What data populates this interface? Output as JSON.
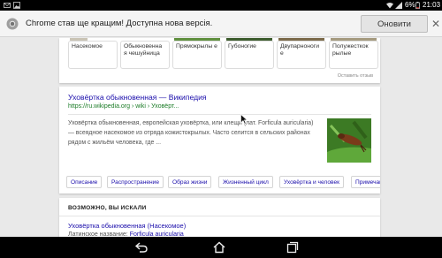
{
  "status_bar": {
    "battery_percent": "6%",
    "time": "21:03",
    "icons": [
      "email-icon",
      "image-icon",
      "wifi-icon",
      "signal-icon",
      "battery-icon"
    ]
  },
  "update_bar": {
    "message": "Chrome став ще кращим! Доступна нова версія.",
    "button_label": "Оновити",
    "close_glyph": "✕",
    "icon": "chrome-icon"
  },
  "related_chips": {
    "items": [
      "Насекомое",
      "Обыкновенна я чешуйница",
      "Прямокрылы е",
      "Губоногие",
      "Двупарноноги е",
      "Полужесткок рылые"
    ],
    "feedback": "Оставить отзыв"
  },
  "result": {
    "title": "Уховёртка обыкновенная — Википедия",
    "url": "https://ru.wikipedia.org › wiki › Уховёрт...",
    "description": "Уховёртка обыкновенная, европейская уховёртка, или клещи (лат. Forficula auricularia) — всеядное насекомое из отряда кожистокрылых. Часто селится в сельских районах рядом с жильём человека, где ...",
    "tabs": [
      "Описание",
      "Распространение",
      "Образ жизни",
      "Жизненный цикл",
      "Уховёртка и человек",
      "Примечания"
    ]
  },
  "related_searches": {
    "heading": "ВОЗМОЖНО, ВЫ ИСКАЛИ",
    "link": "Уховёртка обыкновенная (Насекомое)",
    "sub_label": "Латинское название:",
    "sub_value": "Forficula auricularia"
  },
  "nav_bar": {
    "icons": [
      "back-icon",
      "home-icon",
      "recent-apps-icon"
    ]
  },
  "colors": {
    "link": "#1a0dab",
    "url": "#1a7b26",
    "snippet": "#545454",
    "background": "#e9e9e9"
  }
}
